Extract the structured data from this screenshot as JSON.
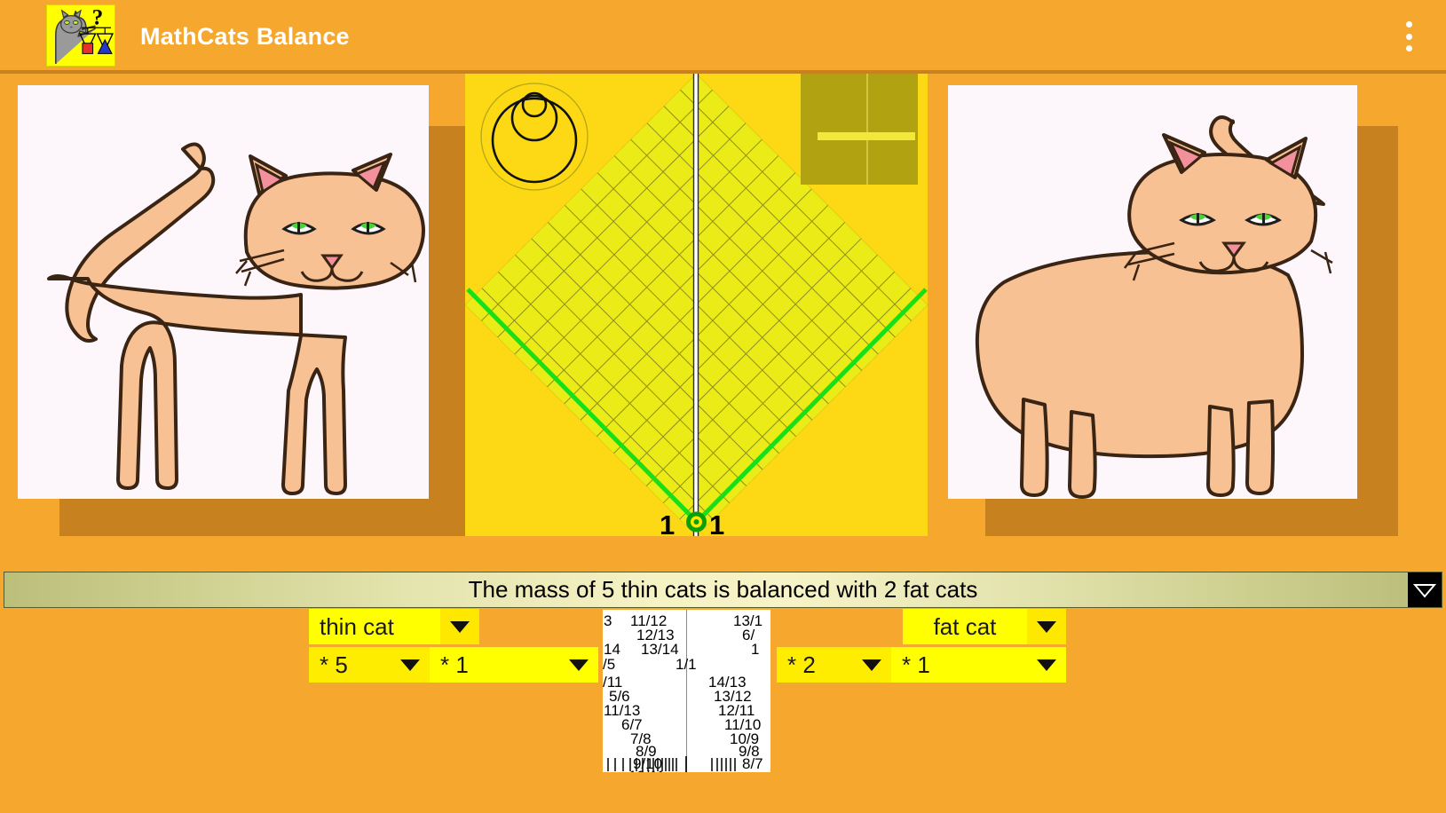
{
  "app": {
    "title": "MathCats Balance",
    "icon_name": "mathcats-balance-app-icon",
    "overflow_menu_label": "More options",
    "accent_orange": "#f5a72e",
    "shelf_brown": "#c8811f",
    "balance_yellow": "#fcd914",
    "grid_yellow": "#eded1a",
    "arm_green": "#18e018",
    "dropdown_yellow": "#ffff00"
  },
  "stage": {
    "left_panel": {
      "name": "thin cat image",
      "alt": "thin cat"
    },
    "right_panel": {
      "name": "fat cat image",
      "alt": "fat cat"
    },
    "balance": {
      "zoom_control_label": "zoom circles",
      "level_indicator_label": "level indicator",
      "pivot_left_value": "1",
      "pivot_right_value": "1"
    }
  },
  "statusbar": {
    "message": "The mass of 5 thin cats is balanced with 2 fat cats",
    "toggle_label": "collapse"
  },
  "controls": {
    "left": {
      "object_name": "thin cat",
      "multiplier_a": "* 5",
      "multiplier_b": "* 1"
    },
    "right": {
      "object_name": "fat cat",
      "multiplier_a": "* 2",
      "multiplier_b": "* 1"
    }
  },
  "fraction_scale": {
    "center_value": "1/1",
    "left_column": [
      "3",
      "11/12",
      "12/13",
      "14",
      "13/14",
      "/5",
      "/11",
      "5/6",
      "11/13",
      "6/7",
      "7/8",
      "8/9",
      "9/10",
      "10/11"
    ],
    "right_column": [
      "13/1",
      "6/",
      "1",
      "14/13",
      "13/12",
      "12/11",
      "11/10",
      "10/9",
      "9/8",
      "8/7"
    ]
  }
}
